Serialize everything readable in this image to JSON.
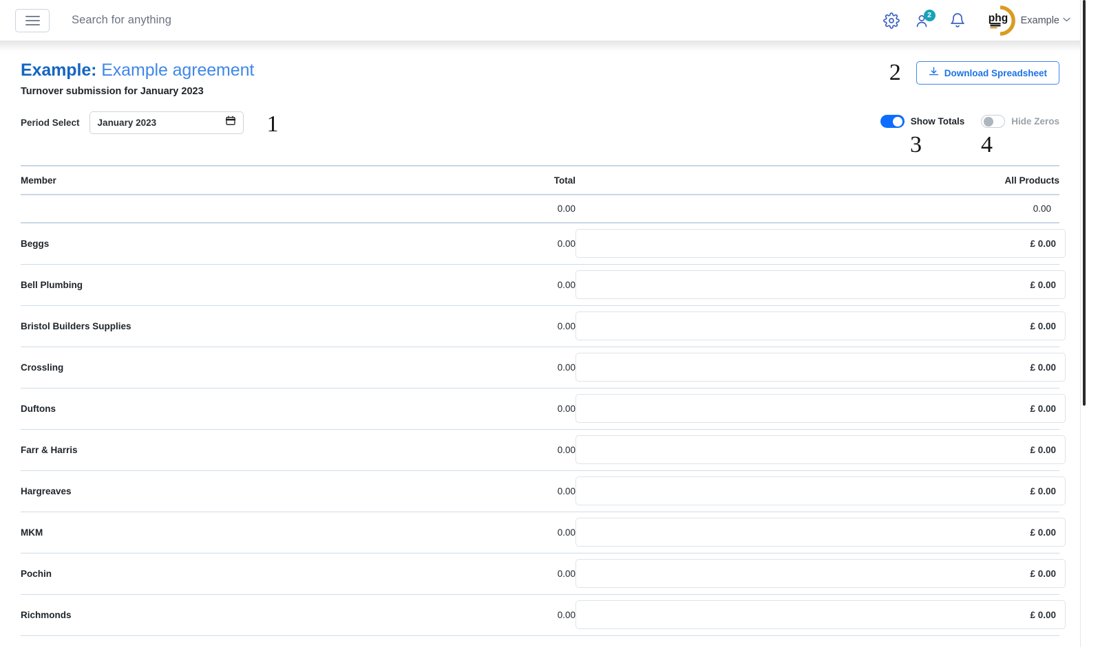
{
  "navbar": {
    "menu_button_name": "menu",
    "search_placeholder": "Search for anything",
    "settings_icon": "gear-icon",
    "users_icon": "users-icon",
    "users_badge": "2",
    "notifications_icon": "bell-icon",
    "logo_text": "phg",
    "logo_sub_line1": "PLUMBING",
    "logo_sub_line2": "HEATING",
    "logo_sub_line3": "GROUP",
    "account_name": "Example",
    "account_caret": "⌄"
  },
  "header": {
    "title_strong": "Example:",
    "title_rest": " Example agreement",
    "subtitle": "Turnover submission for January 2023",
    "download_label": "Download Spreadsheet",
    "download_icon": "download-icon"
  },
  "controls": {
    "period_label": "Period Select",
    "period_value": "January 2023",
    "period_icon": "calendar-icon",
    "show_totals_label": "Show Totals",
    "show_totals_on": true,
    "hide_zeros_label": "Hide Zeros",
    "hide_zeros_on": false
  },
  "annotations": {
    "one": "1",
    "two": "2",
    "three": "3",
    "four": "4"
  },
  "table": {
    "headers": {
      "member": "Member",
      "total": "Total",
      "products": "All Products"
    },
    "totals_row": {
      "member": "",
      "total": "0.00",
      "products": "0.00"
    },
    "rows": [
      {
        "member": "Beggs",
        "total": "0.00",
        "input_value": "£ 0.00"
      },
      {
        "member": "Bell Plumbing",
        "total": "0.00",
        "input_value": "£ 0.00"
      },
      {
        "member": "Bristol Builders Supplies",
        "total": "0.00",
        "input_value": "£ 0.00"
      },
      {
        "member": "Crossling",
        "total": "0.00",
        "input_value": "£ 0.00"
      },
      {
        "member": "Duftons",
        "total": "0.00",
        "input_value": "£ 0.00"
      },
      {
        "member": "Farr & Harris",
        "total": "0.00",
        "input_value": "£ 0.00"
      },
      {
        "member": "Hargreaves",
        "total": "0.00",
        "input_value": "£ 0.00"
      },
      {
        "member": "MKM",
        "total": "0.00",
        "input_value": "£ 0.00"
      },
      {
        "member": "Pochin",
        "total": "0.00",
        "input_value": "£ 0.00"
      },
      {
        "member": "Richmonds",
        "total": "0.00",
        "input_value": "£ 0.00"
      }
    ]
  },
  "colors": {
    "accent_blue": "#1a73e8",
    "title_blue": "#3f87e8",
    "toggle_on": "#0d6efd",
    "badge_teal": "#17a2b8",
    "logo_orange": "#d99b22",
    "table_border": "#c8d7e6"
  }
}
